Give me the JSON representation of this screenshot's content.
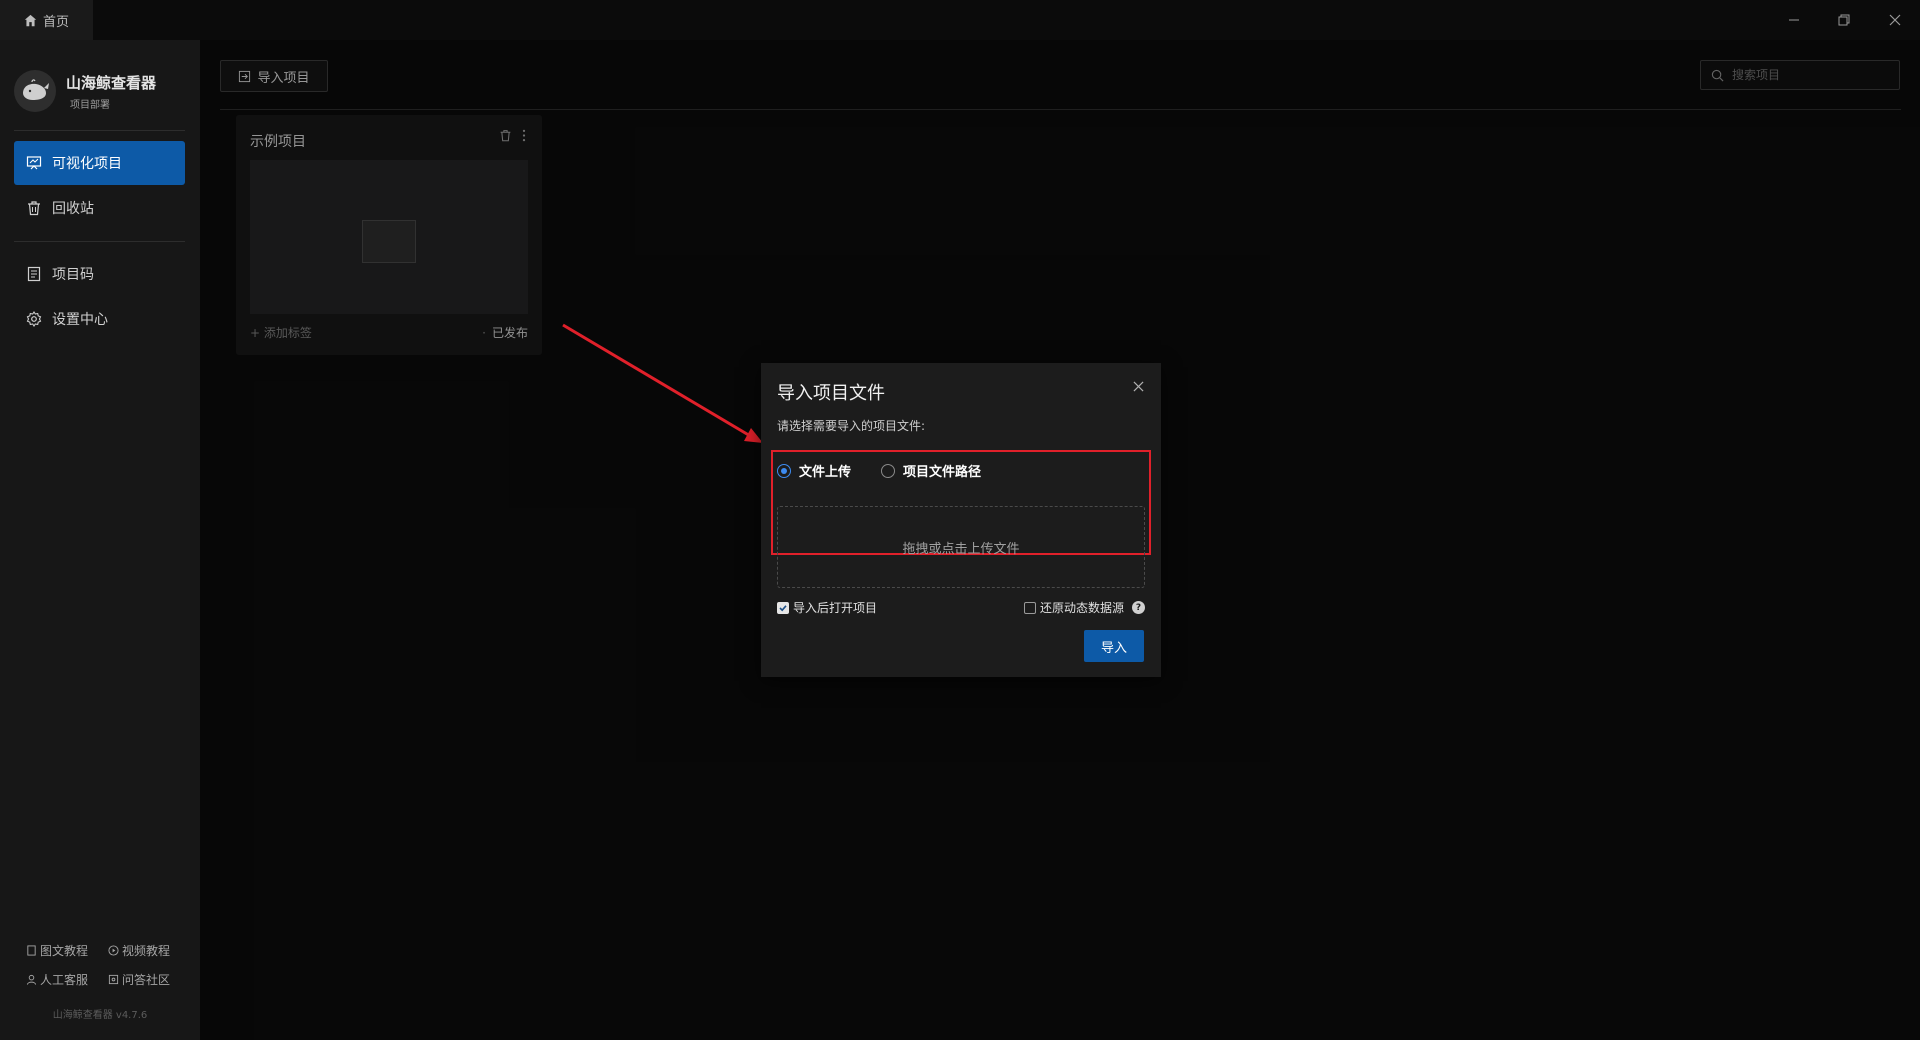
{
  "titlebar": {
    "home_tab": "首页",
    "buttons": [
      "minimize",
      "restore",
      "close"
    ]
  },
  "brand": {
    "name": "山海鲸查看器",
    "subtitle": "项目部署"
  },
  "sidebar": {
    "items": [
      {
        "label": "可视化项目",
        "icon": "presentation-icon",
        "active": true
      },
      {
        "label": "回收站",
        "icon": "trash-icon",
        "active": false
      },
      {
        "label": "项目码",
        "icon": "document-icon",
        "active": false
      },
      {
        "label": "设置中心",
        "icon": "gear-icon",
        "active": false
      }
    ],
    "footer_links": [
      "图文教程",
      "视频教程",
      "人工客服",
      "问答社区"
    ],
    "version": "山海鲸查看器 v4.7.6"
  },
  "toolbar": {
    "import_label": "导入项目",
    "search_placeholder": "搜索项目"
  },
  "project_card": {
    "title": "示例项目",
    "add_tag": "+ 添加标签",
    "status": "已发布"
  },
  "modal": {
    "title": "导入项目文件",
    "description": "请选择需要导入的项目文件:",
    "options": [
      {
        "label": "文件上传",
        "selected": true
      },
      {
        "label": "项目文件路径",
        "selected": false
      }
    ],
    "dropzone_text": "拖拽或点击上传文件",
    "open_after_import": {
      "label": "导入后打开项目",
      "checked": true
    },
    "restore_datasource": {
      "label": "还原动态数据源",
      "checked": false
    },
    "help_symbol": "?",
    "confirm_label": "导入"
  },
  "colors": {
    "accent": "#0d5aa7",
    "highlight": "#e0202a",
    "background": "#0b0b0b",
    "sidebar": "#171717",
    "modal": "#1c1c1c"
  }
}
